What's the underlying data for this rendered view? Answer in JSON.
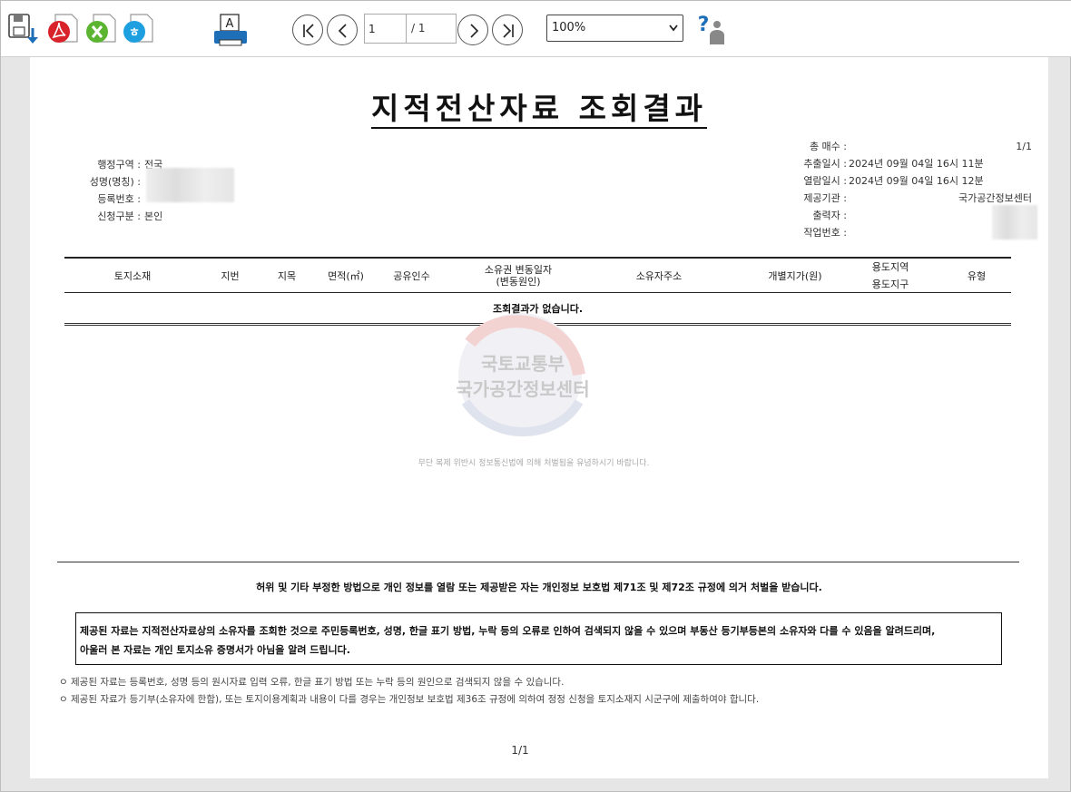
{
  "toolbar": {
    "page_current": "1",
    "page_total": "/ 1",
    "zoom": "100%",
    "icons": [
      "save-download-icon",
      "pdf-icon",
      "excel-icon",
      "hwp-icon",
      "print-icon",
      "help-icon"
    ]
  },
  "document": {
    "title": "지적전산자료 조회결과",
    "left_info": [
      {
        "label": "행정구역 :",
        "value": "전국"
      },
      {
        "label": "성명(명칭) :",
        "value": ""
      },
      {
        "label": "등록번호 :",
        "value": ""
      },
      {
        "label": "신청구분 :",
        "value": "본인"
      }
    ],
    "right_info": [
      {
        "label": "총 매수 :",
        "value": "1/1"
      },
      {
        "label": "추출일시 :",
        "value": "2024년 09월 04일 16시 11분"
      },
      {
        "label": "열람일시 :",
        "value": "2024년 09월 04일 16시 12분"
      },
      {
        "label": "제공기관 :",
        "value": "국가공간정보센터"
      },
      {
        "label": "출력자 :",
        "value": ""
      },
      {
        "label": "작업번호 :",
        "value": ""
      }
    ],
    "table": {
      "headers": [
        "토지소재",
        "지번",
        "지목",
        "면적(㎡)",
        "공유인수",
        "소유권 변동일자\n(변동원인)",
        "소유자주소",
        "개별지가(원)",
        "용도지역\n용도지구",
        "유형"
      ],
      "empty_message": "조회결과가 없습니다."
    },
    "watermark": {
      "line1": "국토교통부",
      "line2": "국가공간정보센터",
      "small": "무단 복제 위반시 정보통신법에 의해 처벌됨을 유념하시기 바랍니다."
    },
    "warning": "허위 및 기타 부정한 방법으로 개인 정보를 열람 또는 제공받은 자는 개인정보 보호법 제71조 및 제72조 규정에 의거 처벌을 받습니다.",
    "notice_line1": "제공된 자료는 지적전산자료상의 소유자를 조회한 것으로 주민등록번호, 성명, 한글 표기 방법, 누락 등의 오류로 인하여 검색되지 않을 수 있으며 부동산 등기부등본의 소유자와 다를 수 있음을 알려드리며,",
    "notice_line2": "아울러 본 자료는 개인 토지소유 증명서가 아님을 알려 드립니다.",
    "notes": [
      "ㅇ 제공된 자료는 등록번호, 성명 등의 원시자료 입력 오류, 한글 표기 방법 또는 누락 등의 원인으로 검색되지 않을 수 있습니다.",
      "ㅇ 제공된 자료가 등기부(소유자에 한함), 또는 토지이용계획과 내용이 다를 경우는 개인정보 보호법 제36조 규정에 의하여 정정 신청을 토지소재지 시군구에 제출하여야 합니다."
    ],
    "page_number": "1/1"
  },
  "colors": {
    "pdf_red": "#d8232a",
    "excel_green": "#5bb531",
    "hwp_blue": "#1ea0e0",
    "print_blue": "#1e6fb8"
  }
}
